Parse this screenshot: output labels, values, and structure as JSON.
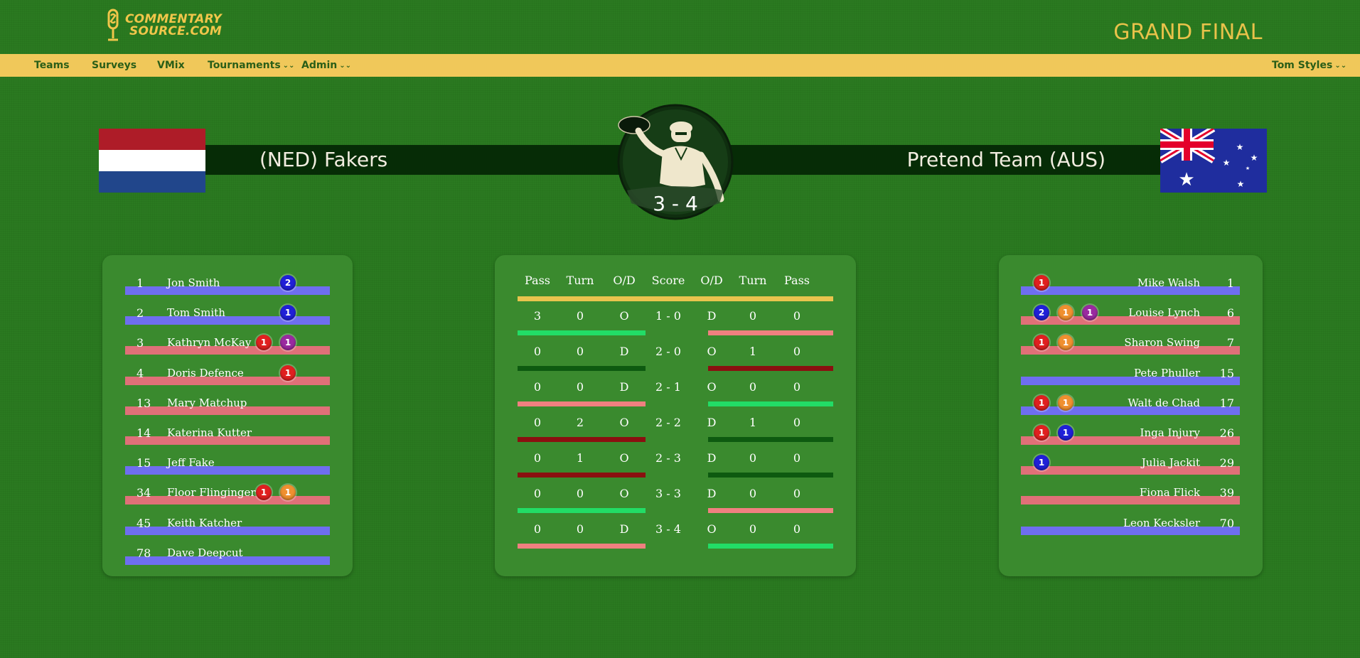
{
  "header": {
    "logo_line1": "COMMENTARY",
    "logo_line2": "SOURCE.COM",
    "page_title": "GRAND FINAL"
  },
  "nav": {
    "teams": "Teams",
    "surveys": "Surveys",
    "vmix": "VMix",
    "tournaments": "Tournaments",
    "admin": "Admin",
    "user": "Tom Styles"
  },
  "match": {
    "team_left": "(NED) Fakers",
    "team_right": "Pretend Team (AUS)",
    "score": "3 - 4"
  },
  "colors": {
    "background": "#2a7a20",
    "nav": "#f0c85a",
    "accent_gold": "#e8c24a",
    "bar_blue": "#6e6ef0",
    "bar_pink": "#e07078",
    "bar_bright_green": "#22dd66",
    "bar_dark_green": "#0d5a10",
    "bar_dark_red": "#8a1010",
    "bar_salmon": "#f08080"
  },
  "left_roster": [
    {
      "num": "1",
      "name": "Jon Smith",
      "bar": "blue",
      "badges": [
        {
          "color": "blue",
          "n": "2"
        }
      ]
    },
    {
      "num": "2",
      "name": "Tom Smith",
      "bar": "blue",
      "badges": [
        {
          "color": "blue",
          "n": "1"
        }
      ]
    },
    {
      "num": "3",
      "name": "Kathryn McKay",
      "bar": "pink",
      "badges": [
        {
          "color": "red",
          "n": "1"
        },
        {
          "color": "purple",
          "n": "1"
        }
      ]
    },
    {
      "num": "4",
      "name": "Doris Defence",
      "bar": "pink",
      "badges": [
        {
          "color": "red",
          "n": "1"
        }
      ]
    },
    {
      "num": "13",
      "name": "Mary Matchup",
      "bar": "pink",
      "badges": []
    },
    {
      "num": "14",
      "name": "Katerina Kutter",
      "bar": "pink",
      "badges": []
    },
    {
      "num": "15",
      "name": "Jeff Fake",
      "bar": "blue",
      "badges": []
    },
    {
      "num": "34",
      "name": "Floor Flinginger",
      "bar": "pink",
      "badges": [
        {
          "color": "red",
          "n": "1"
        },
        {
          "color": "orange",
          "n": "1"
        }
      ]
    },
    {
      "num": "45",
      "name": "Keith Katcher",
      "bar": "blue",
      "badges": []
    },
    {
      "num": "78",
      "name": "Dave Deepcut",
      "bar": "blue",
      "badges": []
    }
  ],
  "right_roster": [
    {
      "num": "1",
      "name": "Mike Walsh",
      "bar": "blue",
      "badges": [
        {
          "color": "red",
          "n": "1"
        }
      ]
    },
    {
      "num": "6",
      "name": "Louise Lynch",
      "bar": "pink",
      "badges": [
        {
          "color": "blue",
          "n": "2"
        },
        {
          "color": "orange",
          "n": "1"
        },
        {
          "color": "purple",
          "n": "1"
        }
      ]
    },
    {
      "num": "7",
      "name": "Sharon Swing",
      "bar": "pink",
      "badges": [
        {
          "color": "red",
          "n": "1"
        },
        {
          "color": "orange",
          "n": "1"
        }
      ]
    },
    {
      "num": "15",
      "name": "Pete Phuller",
      "bar": "blue",
      "badges": []
    },
    {
      "num": "17",
      "name": "Walt de Chad",
      "bar": "blue",
      "badges": [
        {
          "color": "red",
          "n": "1"
        },
        {
          "color": "orange",
          "n": "1"
        }
      ]
    },
    {
      "num": "26",
      "name": "Inga Injury",
      "bar": "pink",
      "badges": [
        {
          "color": "red",
          "n": "1"
        },
        {
          "color": "blue",
          "n": "1"
        }
      ]
    },
    {
      "num": "29",
      "name": "Julia Jackit",
      "bar": "pink",
      "badges": [
        {
          "color": "blue",
          "n": "1"
        }
      ]
    },
    {
      "num": "39",
      "name": "Fiona Flick",
      "bar": "pink",
      "badges": []
    },
    {
      "num": "70",
      "name": "Leon Kecksler",
      "bar": "blue",
      "badges": []
    }
  ],
  "points_table": {
    "headers": [
      "Pass",
      "Turn",
      "O/D",
      "Score",
      "O/D",
      "Turn",
      "Pass"
    ],
    "rows": [
      {
        "l_pass": "3",
        "l_turn": "0",
        "l_od": "O",
        "score": "1 - 0",
        "r_od": "D",
        "r_turn": "0",
        "r_pass": "0",
        "l_bar": "bright_green",
        "r_bar": "salmon"
      },
      {
        "l_pass": "0",
        "l_turn": "0",
        "l_od": "D",
        "score": "2 - 0",
        "r_od": "O",
        "r_turn": "1",
        "r_pass": "0",
        "l_bar": "dark_green",
        "r_bar": "dark_red"
      },
      {
        "l_pass": "0",
        "l_turn": "0",
        "l_od": "D",
        "score": "2 - 1",
        "r_od": "O",
        "r_turn": "0",
        "r_pass": "0",
        "l_bar": "salmon",
        "r_bar": "bright_green"
      },
      {
        "l_pass": "0",
        "l_turn": "2",
        "l_od": "O",
        "score": "2 - 2",
        "r_od": "D",
        "r_turn": "1",
        "r_pass": "0",
        "l_bar": "dark_red",
        "r_bar": "dark_green"
      },
      {
        "l_pass": "0",
        "l_turn": "1",
        "l_od": "O",
        "score": "2 - 3",
        "r_od": "D",
        "r_turn": "0",
        "r_pass": "0",
        "l_bar": "dark_red",
        "r_bar": "dark_green"
      },
      {
        "l_pass": "0",
        "l_turn": "0",
        "l_od": "O",
        "score": "3 - 3",
        "r_od": "D",
        "r_turn": "0",
        "r_pass": "0",
        "l_bar": "bright_green",
        "r_bar": "salmon"
      },
      {
        "l_pass": "0",
        "l_turn": "0",
        "l_od": "D",
        "score": "3 - 4",
        "r_od": "O",
        "r_turn": "0",
        "r_pass": "0",
        "l_bar": "salmon",
        "r_bar": "bright_green"
      }
    ]
  }
}
